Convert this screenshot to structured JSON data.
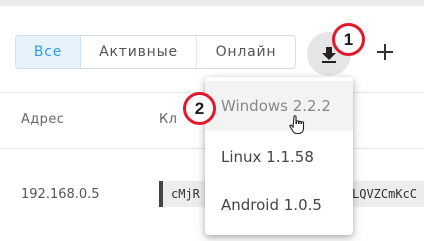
{
  "filter_tabs": [
    {
      "label": "Все",
      "active": true
    },
    {
      "label": "Активные",
      "active": false
    },
    {
      "label": "Онлайн",
      "active": false
    }
  ],
  "toolbar": {
    "download_icon": "download-icon",
    "add_icon": "plus-icon"
  },
  "annotations": {
    "step1": "1",
    "step2": "2",
    "color": "#e5172b"
  },
  "table": {
    "columns": [
      "Адрес",
      "Кл"
    ],
    "rows": [
      {
        "address": "192.168.0.5",
        "key_start": "cMjR",
        "key_end": "LQVZCmKcC"
      }
    ]
  },
  "download_menu": {
    "items": [
      {
        "label": "Windows 2.2.2",
        "hovered": true
      },
      {
        "label": "Linux 1.1.58",
        "hovered": false
      },
      {
        "label": "Android 1.0.5",
        "hovered": false
      }
    ]
  },
  "colors": {
    "accent": "#2f9be8",
    "accent_bg": "#e6f3fd",
    "button_bg": "#e5e5e5"
  }
}
